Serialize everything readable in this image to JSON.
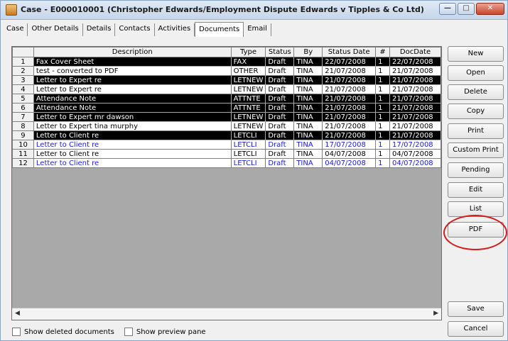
{
  "window": {
    "title": "Case - E000010001 (Christopher Edwards/Employment Dispute Edwards v Tipples & Co Ltd)",
    "buttons": {
      "minimize": "—",
      "maximize": "□",
      "close": "✕"
    }
  },
  "tabs": [
    "Case",
    "Other Details",
    "Details",
    "Contacts",
    "Activities",
    "Documents",
    "Email"
  ],
  "active_tab": "Documents",
  "table": {
    "headers": [
      "Description",
      "Type",
      "Status",
      "By",
      "Status Date",
      "#",
      "DocDate"
    ],
    "rows": [
      {
        "n": "1",
        "desc": "Fax Cover Sheet",
        "type": "FAX",
        "status": "Draft",
        "by": "TINA",
        "sdate": "22/07/2008",
        "hash": "1",
        "ddate": "22/07/2008",
        "style": "dark"
      },
      {
        "n": "2",
        "desc": "test - converted to PDF",
        "type": "OTHER",
        "status": "Draft",
        "by": "TINA",
        "sdate": "21/07/2008",
        "hash": "1",
        "ddate": "21/07/2008",
        "style": "light"
      },
      {
        "n": "3",
        "desc": "Letter to Expert re",
        "type": "LETNEW",
        "status": "Draft",
        "by": "TINA",
        "sdate": "21/07/2008",
        "hash": "1",
        "ddate": "21/07/2008",
        "style": "dark"
      },
      {
        "n": "4",
        "desc": "Letter to Expert re",
        "type": "LETNEW",
        "status": "Draft",
        "by": "TINA",
        "sdate": "21/07/2008",
        "hash": "1",
        "ddate": "21/07/2008",
        "style": "light"
      },
      {
        "n": "5",
        "desc": "Attendance Note",
        "type": "ATTNTE",
        "status": "Draft",
        "by": "TINA",
        "sdate": "21/07/2008",
        "hash": "1",
        "ddate": "21/07/2008",
        "style": "dark"
      },
      {
        "n": "6",
        "desc": "Attendance Note",
        "type": "ATTNTE",
        "status": "Draft",
        "by": "TINA",
        "sdate": "21/07/2008",
        "hash": "1",
        "ddate": "21/07/2008",
        "style": "dark"
      },
      {
        "n": "7",
        "desc": "Letter to Expert mr dawson",
        "type": "LETNEW",
        "status": "Draft",
        "by": "TINA",
        "sdate": "21/07/2008",
        "hash": "1",
        "ddate": "21/07/2008",
        "style": "dark"
      },
      {
        "n": "8",
        "desc": "Letter to Expert tina murphy",
        "type": "LETNEW",
        "status": "Draft",
        "by": "TINA",
        "sdate": "21/07/2008",
        "hash": "1",
        "ddate": "21/07/2008",
        "style": "light"
      },
      {
        "n": "9",
        "desc": "Letter to Client re",
        "type": "LETCLI",
        "status": "Draft",
        "by": "TINA",
        "sdate": "21/07/2008",
        "hash": "1",
        "ddate": "21/07/2008",
        "style": "dark"
      },
      {
        "n": "10",
        "desc": "Letter to Client re",
        "type": "LETCLI",
        "status": "Draft",
        "by": "TINA",
        "sdate": "17/07/2008",
        "hash": "1",
        "ddate": "17/07/2008",
        "style": "blue"
      },
      {
        "n": "11",
        "desc": "Letter to Client re",
        "type": "LETCLI",
        "status": "Draft",
        "by": "TINA",
        "sdate": "04/07/2008",
        "hash": "1",
        "ddate": "04/07/2008",
        "style": "light"
      },
      {
        "n": "12",
        "desc": "Letter to Client re",
        "type": "LETCLI",
        "status": "Draft",
        "by": "TINA",
        "sdate": "04/07/2008",
        "hash": "1",
        "ddate": "04/07/2008",
        "style": "blue"
      }
    ]
  },
  "side_buttons": {
    "new": "New",
    "open": "Open",
    "delete": "Delete",
    "copy": "Copy",
    "print": "Print",
    "custom_print": "Custom Print",
    "pending": "Pending",
    "edit": "Edit",
    "list": "List",
    "pdf": "PDF",
    "save": "Save",
    "cancel": "Cancel"
  },
  "checkboxes": {
    "show_deleted": "Show deleted documents",
    "show_preview": "Show preview pane"
  },
  "colors": {
    "highlight_circle": "#d61a1a",
    "blue_row_text": "#1a1ae6"
  }
}
